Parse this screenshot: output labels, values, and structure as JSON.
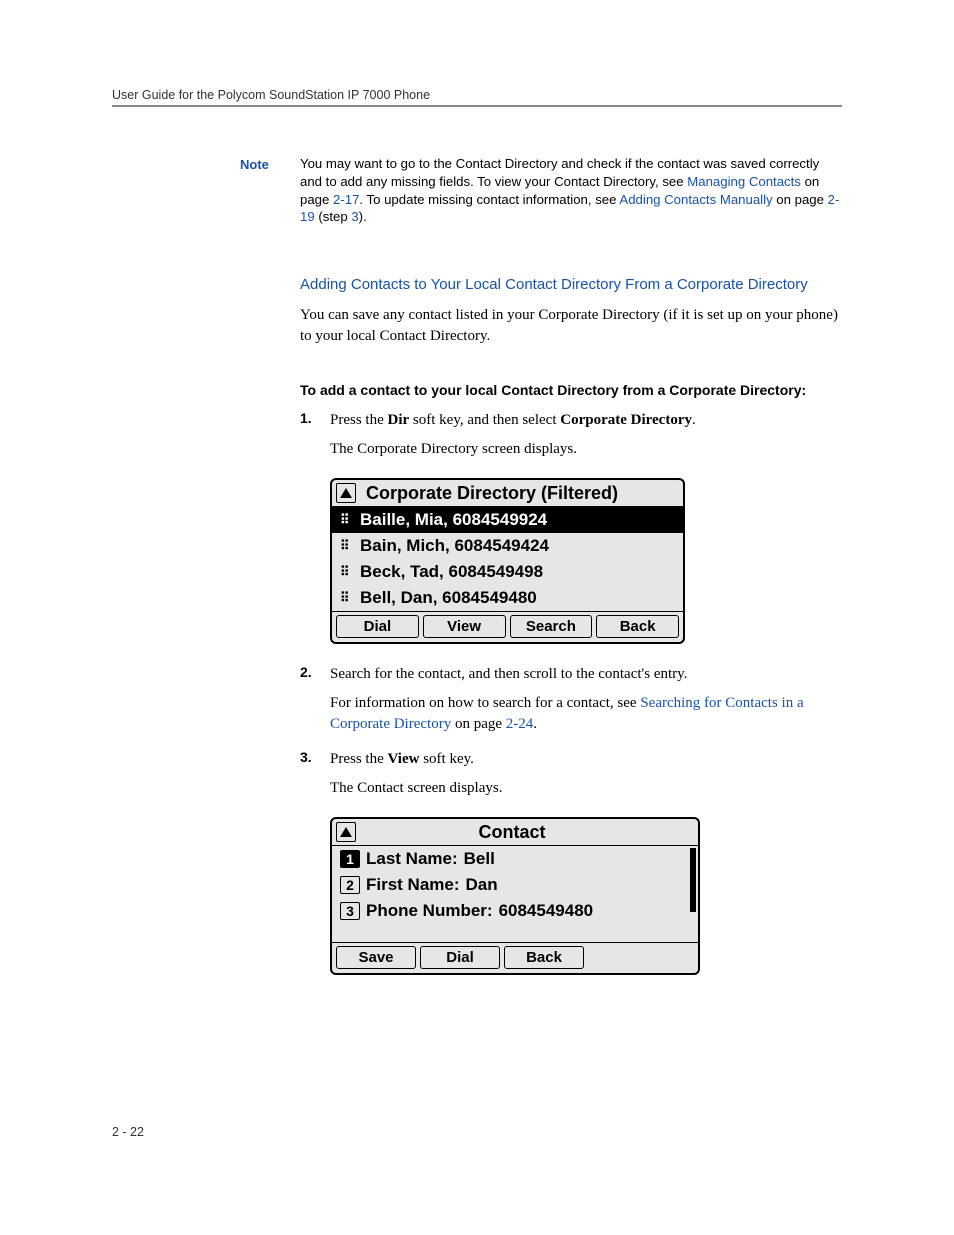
{
  "running_header": "User Guide for the Polycom SoundStation IP 7000 Phone",
  "note": {
    "label": "Note",
    "t1": "You may want to go to the Contact Directory and check if the contact was saved correctly and to add any missing fields. To view your Contact Directory, see ",
    "l1": "Managing Contacts",
    "t2": " on page ",
    "l2": "2-17",
    "t3": ". To update missing contact information, see ",
    "l3": "Adding Contacts Manually",
    "t4": " on page ",
    "l4": "2-19",
    "t5": " (step ",
    "l5": "3",
    "t6": ")."
  },
  "h3": "Adding Contacts to Your Local Contact Directory From a Corporate Directory",
  "intro": "You can save any contact listed in your Corporate Directory (if it is set up on your phone) to your local Contact Directory.",
  "h4": "To add a contact to your local Contact Directory from a Corporate Directory:",
  "step1": {
    "num": "1.",
    "a1": "Press the ",
    "b1": "Dir",
    "a2": " soft key, and then select ",
    "b2": "Corporate Directory",
    "a3": ".",
    "sub": "The Corporate Directory screen displays."
  },
  "lcd1": {
    "title": "Corporate Directory (Filtered)",
    "rows": [
      "Baille, Mia,  6084549924",
      "Bain, Mich,  6084549424",
      "Beck, Tad,  6084549498",
      "Bell, Dan,  6084549480"
    ],
    "keys": [
      "Dial",
      "View",
      "Search",
      "Back"
    ]
  },
  "step2": {
    "num": "2.",
    "text": "Search for the contact, and then scroll to the contact's entry.",
    "sub_a": "For information on how to search for a contact, see ",
    "sub_l1": "Searching for Contacts in a Corporate Directory",
    "sub_b": " on page ",
    "sub_l2": "2-24",
    "sub_c": "."
  },
  "step3": {
    "num": "3.",
    "a1": "Press the ",
    "b1": "View",
    "a2": " soft key.",
    "sub": "The Contact screen displays."
  },
  "lcd2": {
    "title": "Contact",
    "fields": [
      {
        "label": "Last Name:",
        "value": "Bell"
      },
      {
        "label": "First Name:",
        "value": "Dan"
      },
      {
        "label": "Phone Number:",
        "value": "6084549480"
      }
    ],
    "nums": [
      "1",
      "2",
      "3"
    ],
    "keys": [
      "Save",
      "Dial",
      "Back"
    ]
  },
  "page_number": "2 - 22"
}
